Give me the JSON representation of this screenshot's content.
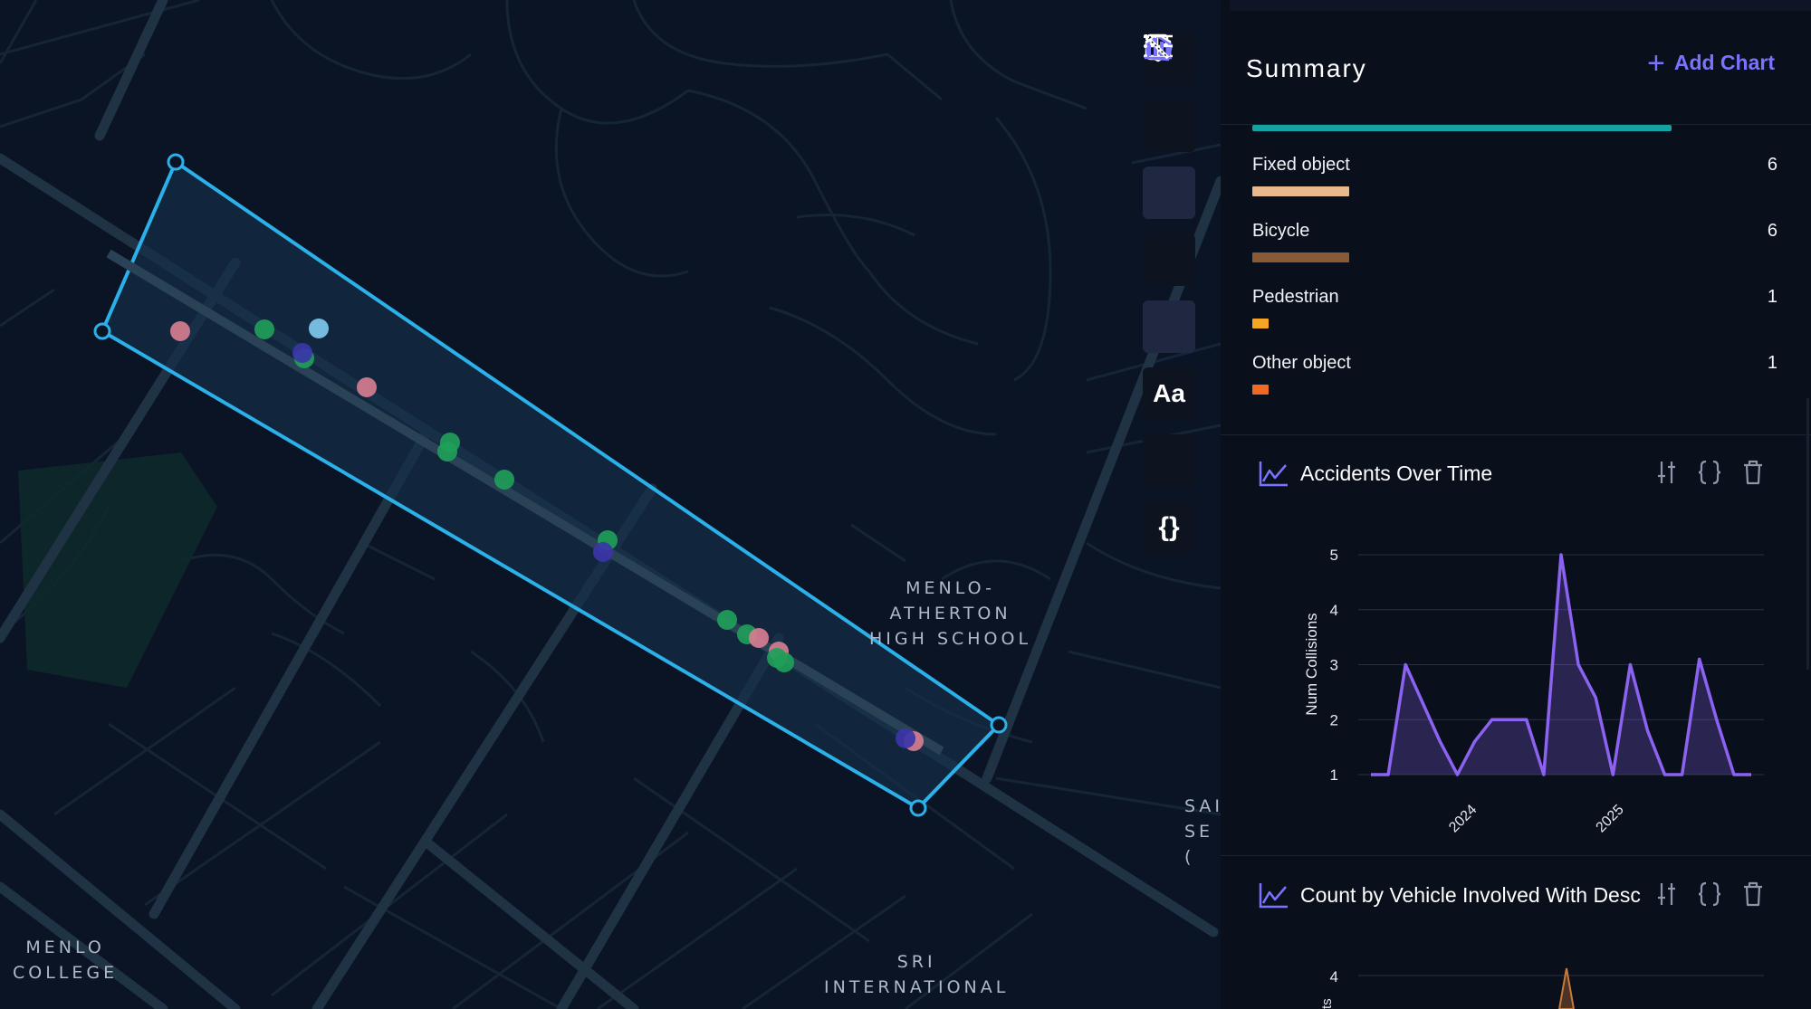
{
  "map": {
    "labels": {
      "menlo_atherton": "MENLO-\nATHERTON\nHIGH SCHOOL",
      "menlo_college": "MENLO\nCOLLEGE",
      "sri": "SRI\nINTERNATIONAL",
      "right_cut": "SAI\nSE\n("
    },
    "colors": {
      "background": "#0b1424",
      "road": "#1f3344",
      "polygon_stroke": "#2bb0ea",
      "polygon_fill": "#16304a"
    },
    "point_colors": {
      "green": "#1f9e59",
      "pink": "#d67d90",
      "indigo": "#3b35a8",
      "light_blue": "#7ec8ec"
    }
  },
  "toolbar": {
    "items": [
      {
        "icon": "split-view-icon"
      },
      {
        "icon": "cube-icon"
      },
      {
        "icon": "polygon-draw-icon",
        "active": true
      },
      {
        "icon": "list-icon"
      },
      {
        "icon": "bar-chart-icon",
        "active": true
      },
      {
        "icon": "text-icon",
        "label": "Aa"
      },
      {
        "icon": "magic-wand-icon"
      },
      {
        "icon": "code-braces-icon",
        "label": "{}"
      }
    ]
  },
  "panel": {
    "title": "Summary",
    "add_chart_label": "Add Chart",
    "top_bar_color": "#14a3a2",
    "categories": [
      {
        "name": "Fixed object",
        "count": "6",
        "color": "#e8b98c",
        "fraction": 1.0
      },
      {
        "name": "Bicycle",
        "count": "6",
        "color": "#8a5a36",
        "fraction": 1.0
      },
      {
        "name": "Pedestrian",
        "count": "1",
        "color": "#f5a623",
        "fraction": 0.17
      },
      {
        "name": "Other object",
        "count": "1",
        "color": "#f06a24",
        "fraction": 0.17
      }
    ],
    "charts": [
      {
        "title": "Accidents Over Time",
        "icon": "line-chart-icon"
      },
      {
        "title": "Count by Vehicle Involved With Desc",
        "icon": "line-chart-icon"
      }
    ],
    "card_action_icons": [
      "sliders-icon",
      "code-braces-icon",
      "trash-icon"
    ]
  },
  "chart_data": [
    {
      "type": "area",
      "title": "Accidents Over Time",
      "ylabel": "Num Collisions",
      "xlabel": "",
      "ylim": [
        1,
        5
      ],
      "yticks": [
        "1",
        "2",
        "3",
        "4",
        "5"
      ],
      "xtick_labels": [
        "2024",
        "2025"
      ],
      "color": "#8b63f0",
      "values": [
        1,
        1,
        3,
        2.3,
        1.6,
        1,
        1.6,
        2,
        2,
        2,
        1,
        5,
        3,
        2.4,
        1,
        3,
        1.8,
        1,
        1,
        3.1,
        2,
        1,
        1
      ]
    },
    {
      "type": "area",
      "title": "Count by Vehicle Involved With Desc",
      "yticks_visible": [
        "4"
      ],
      "color": "#c77a3a"
    }
  ]
}
